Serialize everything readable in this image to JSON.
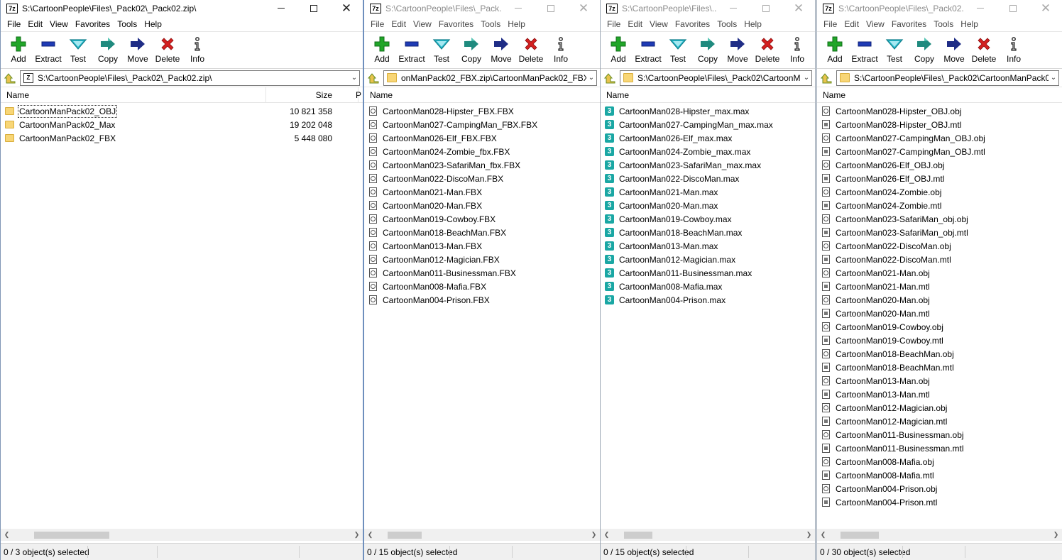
{
  "windows": [
    {
      "title": "S:\\CartoonPeople\\Files\\_Pack02\\_Pack02.zip\\",
      "active": true,
      "menu": [
        "File",
        "Edit",
        "View",
        "Favorites",
        "Tools",
        "Help"
      ],
      "toolbar": [
        "Add",
        "Extract",
        "Test",
        "Copy",
        "Move",
        "Delete",
        "Info"
      ],
      "address": "S:\\CartoonPeople\\Files\\_Pack02\\_Pack02.zip\\",
      "address_icon": "zip-archive-icon",
      "columns": {
        "name": "Name",
        "size": "Size",
        "more": "P"
      },
      "items": [
        {
          "name": "CartoonManPack02_OBJ",
          "size": "10 821 358",
          "type": "folder"
        },
        {
          "name": "CartoonManPack02_Max",
          "size": "19 202 048",
          "type": "folder"
        },
        {
          "name": "CartoonManPack02_FBX",
          "size": "5 448 080",
          "type": "folder"
        }
      ],
      "status": "0 / 3 object(s) selected"
    },
    {
      "title": "S:\\CartoonPeople\\Files\\_Pack...",
      "active": false,
      "menu": [
        "File",
        "Edit",
        "View",
        "Favorites",
        "Tools",
        "Help"
      ],
      "toolbar": [
        "Add",
        "Extract",
        "Test",
        "Copy",
        "Move",
        "Delete",
        "Info"
      ],
      "address": "onManPack02_FBX.zip\\CartoonManPack02_FBX\\",
      "address_icon": "folder-icon",
      "columns": {
        "name": "Name"
      },
      "items": [
        {
          "name": "CartoonMan028-Hipster_FBX.FBX",
          "type": "fbx"
        },
        {
          "name": "CartoonMan027-CampingMan_FBX.FBX",
          "type": "fbx"
        },
        {
          "name": "CartoonMan026-Elf_FBX.FBX",
          "type": "fbx"
        },
        {
          "name": "CartoonMan024-Zombie_fbx.FBX",
          "type": "fbx"
        },
        {
          "name": "CartoonMan023-SafariMan_fbx.FBX",
          "type": "fbx"
        },
        {
          "name": "CartoonMan022-DiscoMan.FBX",
          "type": "fbx"
        },
        {
          "name": "CartoonMan021-Man.FBX",
          "type": "fbx"
        },
        {
          "name": "CartoonMan020-Man.FBX",
          "type": "fbx"
        },
        {
          "name": "CartoonMan019-Cowboy.FBX",
          "type": "fbx"
        },
        {
          "name": "CartoonMan018-BeachMan.FBX",
          "type": "fbx"
        },
        {
          "name": "CartoonMan013-Man.FBX",
          "type": "fbx"
        },
        {
          "name": "CartoonMan012-Magician.FBX",
          "type": "fbx"
        },
        {
          "name": "CartoonMan011-Businessman.FBX",
          "type": "fbx"
        },
        {
          "name": "CartoonMan008-Mafia.FBX",
          "type": "fbx"
        },
        {
          "name": "CartoonMan004-Prison.FBX",
          "type": "fbx"
        }
      ],
      "status": "0 / 15 object(s) selected"
    },
    {
      "title": "S:\\CartoonPeople\\Files\\...",
      "active": false,
      "menu": [
        "File",
        "Edit",
        "View",
        "Favorites",
        "Tools",
        "Help"
      ],
      "toolbar": [
        "Add",
        "Extract",
        "Test",
        "Copy",
        "Move",
        "Delete",
        "Info"
      ],
      "address": "S:\\CartoonPeople\\Files\\_Pack02\\CartoonM",
      "address_icon": "folder-icon",
      "columns": {
        "name": "Name"
      },
      "items": [
        {
          "name": "CartoonMan028-Hipster_max.max",
          "type": "max"
        },
        {
          "name": "CartoonMan027-CampingMan_max.max",
          "type": "max"
        },
        {
          "name": "CartoonMan026-Elf_max.max",
          "type": "max"
        },
        {
          "name": "CartoonMan024-Zombie_max.max",
          "type": "max"
        },
        {
          "name": "CartoonMan023-SafariMan_max.max",
          "type": "max"
        },
        {
          "name": "CartoonMan022-DiscoMan.max",
          "type": "max"
        },
        {
          "name": "CartoonMan021-Man.max",
          "type": "max"
        },
        {
          "name": "CartoonMan020-Man.max",
          "type": "max"
        },
        {
          "name": "CartoonMan019-Cowboy.max",
          "type": "max"
        },
        {
          "name": "CartoonMan018-BeachMan.max",
          "type": "max"
        },
        {
          "name": "CartoonMan013-Man.max",
          "type": "max"
        },
        {
          "name": "CartoonMan012-Magician.max",
          "type": "max"
        },
        {
          "name": "CartoonMan011-Businessman.max",
          "type": "max"
        },
        {
          "name": "CartoonMan008-Mafia.max",
          "type": "max"
        },
        {
          "name": "CartoonMan004-Prison.max",
          "type": "max"
        }
      ],
      "status": "0 / 15 object(s) selected"
    },
    {
      "title": "S:\\CartoonPeople\\Files\\_Pack02...",
      "active": false,
      "menu": [
        "File",
        "Edit",
        "View",
        "Favorites",
        "Tools",
        "Help"
      ],
      "toolbar": [
        "Add",
        "Extract",
        "Test",
        "Copy",
        "Move",
        "Delete",
        "Info"
      ],
      "address": "S:\\CartoonPeople\\Files\\_Pack02\\CartoonManPack0",
      "address_icon": "folder-icon",
      "columns": {
        "name": "Name"
      },
      "items": [
        {
          "name": "CartoonMan028-Hipster_OBJ.obj",
          "type": "obj"
        },
        {
          "name": "CartoonMan028-Hipster_OBJ.mtl",
          "type": "mtl"
        },
        {
          "name": "CartoonMan027-CampingMan_OBJ.obj",
          "type": "obj"
        },
        {
          "name": "CartoonMan027-CampingMan_OBJ.mtl",
          "type": "mtl"
        },
        {
          "name": "CartoonMan026-Elf_OBJ.obj",
          "type": "obj"
        },
        {
          "name": "CartoonMan026-Elf_OBJ.mtl",
          "type": "mtl"
        },
        {
          "name": "CartoonMan024-Zombie.obj",
          "type": "obj"
        },
        {
          "name": "CartoonMan024-Zombie.mtl",
          "type": "mtl"
        },
        {
          "name": "CartoonMan023-SafariMan_obj.obj",
          "type": "obj"
        },
        {
          "name": "CartoonMan023-SafariMan_obj.mtl",
          "type": "mtl"
        },
        {
          "name": "CartoonMan022-DiscoMan.obj",
          "type": "obj"
        },
        {
          "name": "CartoonMan022-DiscoMan.mtl",
          "type": "mtl"
        },
        {
          "name": "CartoonMan021-Man.obj",
          "type": "obj"
        },
        {
          "name": "CartoonMan021-Man.mtl",
          "type": "mtl"
        },
        {
          "name": "CartoonMan020-Man.obj",
          "type": "obj"
        },
        {
          "name": "CartoonMan020-Man.mtl",
          "type": "mtl"
        },
        {
          "name": "CartoonMan019-Cowboy.obj",
          "type": "obj"
        },
        {
          "name": "CartoonMan019-Cowboy.mtl",
          "type": "mtl"
        },
        {
          "name": "CartoonMan018-BeachMan.obj",
          "type": "obj"
        },
        {
          "name": "CartoonMan018-BeachMan.mtl",
          "type": "mtl"
        },
        {
          "name": "CartoonMan013-Man.obj",
          "type": "obj"
        },
        {
          "name": "CartoonMan013-Man.mtl",
          "type": "mtl"
        },
        {
          "name": "CartoonMan012-Magician.obj",
          "type": "obj"
        },
        {
          "name": "CartoonMan012-Magician.mtl",
          "type": "mtl"
        },
        {
          "name": "CartoonMan011-Businessman.obj",
          "type": "obj"
        },
        {
          "name": "CartoonMan011-Businessman.mtl",
          "type": "mtl"
        },
        {
          "name": "CartoonMan008-Mafia.obj",
          "type": "obj"
        },
        {
          "name": "CartoonMan008-Mafia.mtl",
          "type": "mtl"
        },
        {
          "name": "CartoonMan004-Prison.obj",
          "type": "obj"
        },
        {
          "name": "CartoonMan004-Prison.mtl",
          "type": "mtl"
        }
      ],
      "status": "0 / 30 object(s) selected"
    }
  ],
  "app_logo": "7z",
  "colors": {
    "add": "#21a629",
    "extract": "#1f3bb5",
    "test": "#23b7c9",
    "copy": "#1f8a7e",
    "move": "#1f2d86",
    "delete": "#d42020",
    "info": "#1a1a1a",
    "folder": "#f8d676",
    "max_icon": "#1aa7a4"
  }
}
